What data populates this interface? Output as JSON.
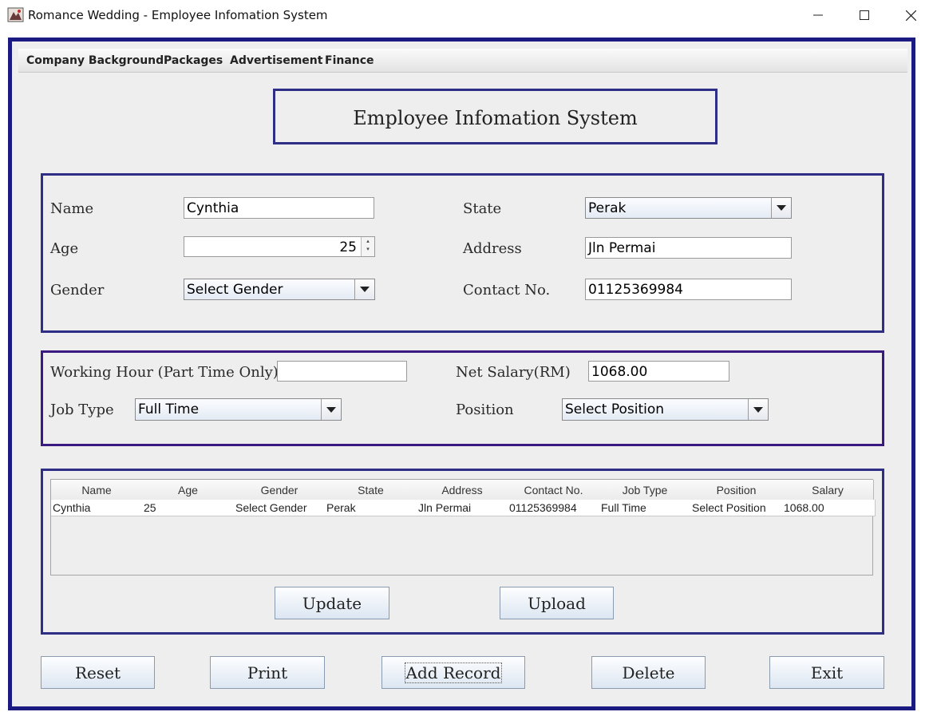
{
  "window": {
    "title": "Romance Wedding - Employee Infomation System"
  },
  "menu": [
    "Company Background",
    "Packages",
    "Advertisement",
    "Finance"
  ],
  "heading": "Employee Infomation System",
  "form": {
    "name_label": "Name",
    "name_value": "Cynthia",
    "age_label": "Age",
    "age_value": "25",
    "gender_label": "Gender",
    "gender_value": "Select Gender",
    "state_label": "State",
    "state_value": "Perak",
    "address_label": "Address",
    "address_value": "Jln Permai",
    "contact_label": "Contact No.",
    "contact_value": "01125369984"
  },
  "job": {
    "working_hour_label": "Working Hour (Part Time Only)",
    "working_hour_value": "",
    "job_type_label": "Job Type",
    "job_type_value": "Full Time",
    "net_salary_label": "Net Salary(RM)",
    "net_salary_value": "1068.00",
    "position_label": "Position",
    "position_value": "Select Position"
  },
  "table": {
    "columns": [
      "Name",
      "Age",
      "Gender",
      "State",
      "Address",
      "Contact No.",
      "Job Type",
      "Position",
      "Salary"
    ],
    "rows": [
      [
        "Cynthia",
        "25",
        "Select Gender",
        "Perak",
        "Jln Permai",
        "01125369984",
        "Full Time",
        "Select Position",
        "1068.00"
      ]
    ]
  },
  "panel_buttons": {
    "update": "Update",
    "upload": "Upload"
  },
  "buttons": {
    "reset": "Reset",
    "print": "Print",
    "add_record": "Add Record",
    "delete": "Delete",
    "exit": "Exit"
  },
  "colors": {
    "frame_border": "#1a1a80",
    "panel_border": "#2e2e86",
    "background": "#eeeeee"
  }
}
